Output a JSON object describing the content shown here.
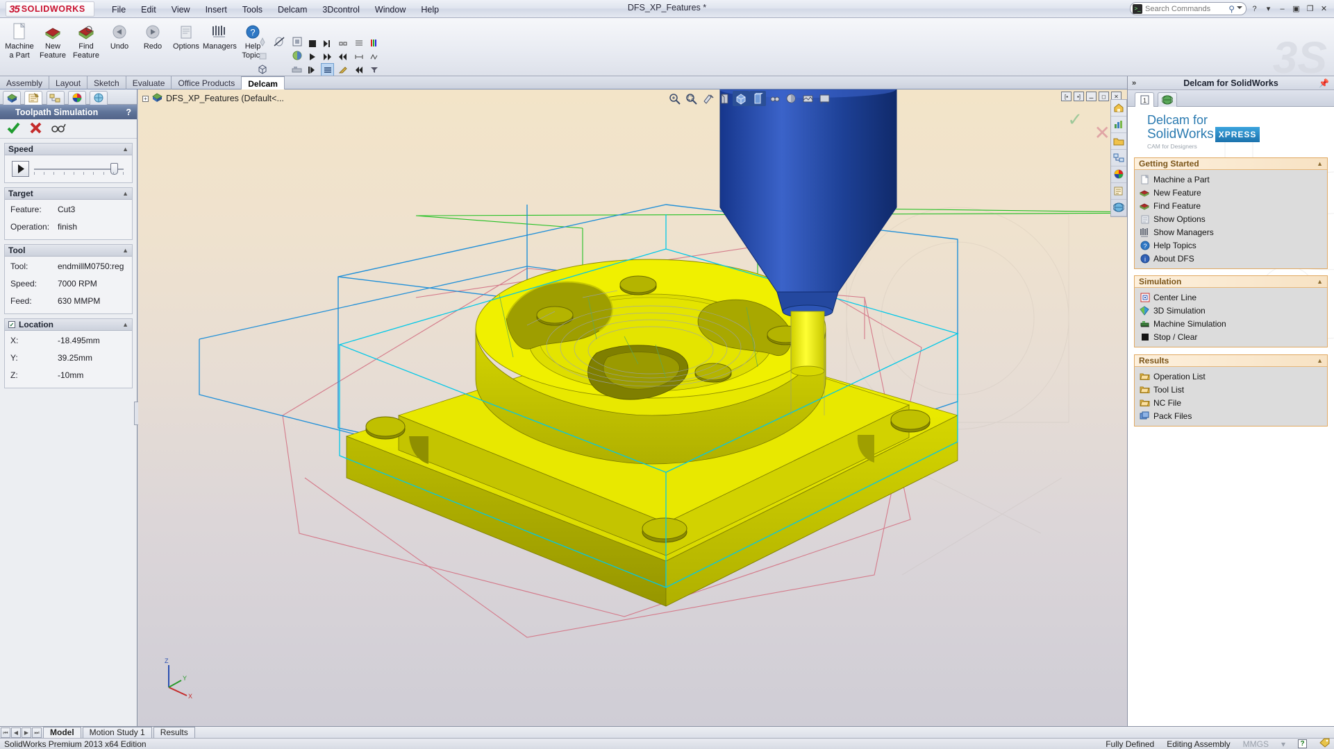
{
  "titlebar": {
    "logo_mark": "35",
    "logo_name": "SOLIDWORKS",
    "doc_title": "DFS_XP_Features *",
    "menus": [
      "File",
      "Edit",
      "View",
      "Insert",
      "Tools",
      "Delcam",
      "3Dcontrol",
      "Window",
      "Help"
    ],
    "search_placeholder": "Search Commands",
    "search_value": "",
    "help_icon": "?",
    "minimize_icon": "–",
    "restore_icon": "❐",
    "maximize_icon": "❐",
    "close_icon": "✕"
  },
  "ribbon": {
    "buttons": [
      {
        "label_line1": "Machine",
        "label_line2": "a Part",
        "icon": "document-icon"
      },
      {
        "label_line1": "New",
        "label_line2": "Feature",
        "icon": "new-feature-icon"
      },
      {
        "label_line1": "Find",
        "label_line2": "Feature",
        "icon": "find-feature-icon"
      },
      {
        "label_line1": "Undo",
        "label_line2": "",
        "icon": "undo-icon"
      },
      {
        "label_line1": "Redo",
        "label_line2": "",
        "icon": "redo-icon"
      },
      {
        "label_line1": "Options",
        "label_line2": "",
        "icon": "options-icon"
      },
      {
        "label_line1": "Managers",
        "label_line2": "",
        "icon": "managers-icon"
      },
      {
        "label_line1": "Help",
        "label_line2": "Topics",
        "icon": "help-icon"
      }
    ]
  },
  "doctabs": {
    "tabs": [
      "Assembly",
      "Layout",
      "Sketch",
      "Evaluate",
      "Office Products",
      "Delcam"
    ],
    "active": "Delcam"
  },
  "left_panel": {
    "tabs": [
      "feature-manager-tab",
      "property-manager-tab",
      "configuration-manager-tab",
      "display-manager-tab",
      "dimxpert-tab"
    ],
    "active_tab_index": 1,
    "header_title": "Toolpath Simulation",
    "header_help": "?",
    "actions": [
      "ok-check-icon",
      "cancel-x-icon",
      "glasses-icon"
    ],
    "speed": {
      "title": "Speed",
      "play_icon": "play-icon",
      "slider_value": 95
    },
    "target": {
      "title": "Target",
      "rows": [
        {
          "key": "Feature:",
          "value": "Cut3"
        },
        {
          "key": "Operation:",
          "value": "finish"
        }
      ]
    },
    "tool": {
      "title": "Tool",
      "rows": [
        {
          "key": "Tool:",
          "value": "endmillM0750:reg"
        },
        {
          "key": "Speed:",
          "value": "7000 RPM"
        },
        {
          "key": "Feed:",
          "value": "630 MMPM"
        }
      ]
    },
    "location": {
      "title": "Location",
      "checked": true,
      "rows": [
        {
          "key": "X:",
          "value": "-18.495mm"
        },
        {
          "key": "Y:",
          "value": "39.25mm"
        },
        {
          "key": "Z:",
          "value": "-10mm"
        }
      ]
    }
  },
  "viewport": {
    "tree_label": "DFS_XP_Features  (Default<...",
    "tree_expand": "+",
    "toolbar_icons": [
      "zoom-to-fit-icon",
      "zoom-to-area-icon",
      "previous-view-icon",
      "section-view-icon",
      "view-orientation-icon",
      "display-style-icon",
      "hide-show-icon",
      "appearance-icon",
      "scene-icon",
      "view-settings-icon"
    ],
    "window_buttons": [
      "restore-left-icon",
      "restore-right-icon",
      "minimize-icon",
      "maximize-icon",
      "close-icon"
    ],
    "confirm_icon": "✓",
    "cancel_icon": "✕",
    "right_strip_icons": [
      "home-icon",
      "chart-icon",
      "folder-icon",
      "appearance-map-icon",
      "color-wheel-icon",
      "notes-icon",
      "globe-icon"
    ],
    "triad": {
      "x": "X",
      "y": "Y",
      "z": "Z"
    }
  },
  "taskpane": {
    "header_title": "Delcam for SolidWorks",
    "collapse_icon": "»",
    "pin_icon": "pin-icon",
    "tabs": [
      "delcam-tab",
      "web-tab"
    ],
    "active_tab_index": 0,
    "brand": {
      "line1": "Delcam for",
      "line2": "SolidWorks",
      "badge": "XPRESS",
      "tagline": "CAM for Designers"
    },
    "sections": [
      {
        "title": "Getting Started",
        "collapse_icon": "▲",
        "items": [
          {
            "label": "Machine a Part",
            "icon": "document-icon"
          },
          {
            "label": "New Feature",
            "icon": "new-feature-icon"
          },
          {
            "label": "Find Feature",
            "icon": "find-feature-icon"
          },
          {
            "label": "Show Options",
            "icon": "options-icon"
          },
          {
            "label": "Show Managers",
            "icon": "managers-icon"
          },
          {
            "label": "Help Topics",
            "icon": "help-icon"
          },
          {
            "label": "About DFS",
            "icon": "info-icon"
          }
        ]
      },
      {
        "title": "Simulation",
        "collapse_icon": "▲",
        "items": [
          {
            "label": "Center Line",
            "icon": "center-line-icon"
          },
          {
            "label": "3D Simulation",
            "icon": "3d-simulation-icon"
          },
          {
            "label": "Machine Simulation",
            "icon": "machine-simulation-icon"
          },
          {
            "label": "Stop / Clear",
            "icon": "stop-icon"
          }
        ]
      },
      {
        "title": "Results",
        "collapse_icon": "▲",
        "items": [
          {
            "label": "Operation List",
            "icon": "folder-icon"
          },
          {
            "label": "Tool List",
            "icon": "folder-icon"
          },
          {
            "label": "NC File",
            "icon": "folder-icon"
          },
          {
            "label": "Pack Files",
            "icon": "pack-files-icon"
          }
        ]
      }
    ]
  },
  "bottom": {
    "nav_buttons": [
      "first-icon",
      "prev-icon",
      "next-icon",
      "last-icon"
    ],
    "tabs": [
      "Model",
      "Motion Study 1",
      "Results"
    ],
    "active_tab": "Model"
  },
  "statusbar": {
    "left_text": "SolidWorks Premium 2013 x64 Edition",
    "fully_defined": "Fully Defined",
    "editing": "Editing Assembly",
    "units": "MMGS",
    "units_arrow": "▾",
    "help_badge": "?",
    "tag_icon": "tag-icon"
  },
  "colors": {
    "accent_blue": "#2a7ab0",
    "part_yellow": "#e8e800",
    "tool_blue": "#1b4ea8",
    "section_orange": "#e0a861",
    "header_blue": "#5f7499"
  }
}
